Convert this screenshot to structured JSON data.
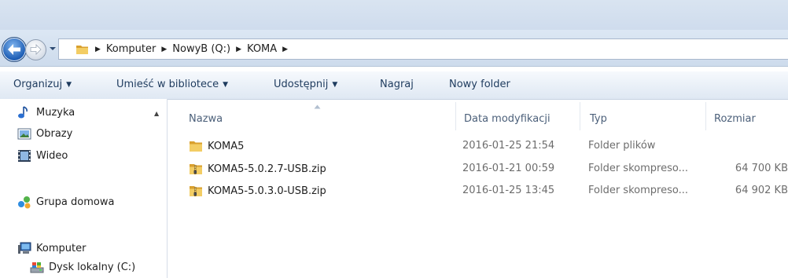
{
  "address": {
    "breadcrumbs": [
      "Komputer",
      "NowyB (Q:)",
      "KOMA"
    ]
  },
  "toolbar": {
    "organize": "Organizuj",
    "include_in_library": "Umieść w bibliotece",
    "share": "Udostępnij",
    "burn": "Nagraj",
    "new_folder": "Nowy folder"
  },
  "sidebar": {
    "items": [
      {
        "label": "Muzyka",
        "icon": "music-icon"
      },
      {
        "label": "Obrazy",
        "icon": "pictures-icon"
      },
      {
        "label": "Wideo",
        "icon": "video-icon"
      },
      {
        "label": "Grupa domowa",
        "icon": "homegroup-icon"
      },
      {
        "label": "Komputer",
        "icon": "computer-icon"
      },
      {
        "label": "Dysk lokalny (C:)",
        "icon": "drive-icon"
      }
    ]
  },
  "columns": {
    "name": "Nazwa",
    "date": "Data modyfikacji",
    "type": "Typ",
    "size": "Rozmiar"
  },
  "files": [
    {
      "name": "KOMA5",
      "date": "2016-01-25 21:54",
      "type": "Folder plików",
      "size": "",
      "icon": "folder-icon"
    },
    {
      "name": "KOMA5-5.0.2.7-USB.zip",
      "date": "2016-01-21 00:59",
      "type": "Folder skompreso...",
      "size": "64 700 KB",
      "icon": "zip-folder-icon"
    },
    {
      "name": "KOMA5-5.0.3.0-USB.zip",
      "date": "2016-01-25 13:45",
      "type": "Folder skompreso...",
      "size": "64 902 KB",
      "icon": "zip-folder-icon"
    }
  ],
  "colors": {
    "toolbar_text": "#1e3b5e",
    "header_text": "#4c607a",
    "detail_text": "#6d6d6d",
    "folder": "#e8b94a"
  }
}
